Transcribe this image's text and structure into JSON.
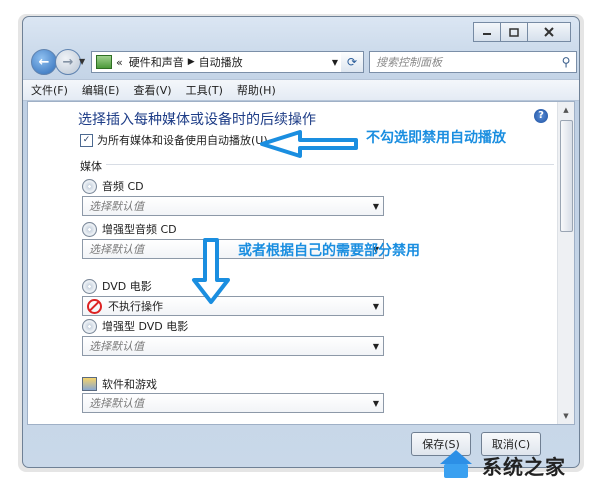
{
  "address": {
    "back_label": "←",
    "forward_label": "→",
    "history_glyph": "«",
    "crumbs": [
      "硬件和声音",
      "自动播放"
    ],
    "search_placeholder": "搜索控制面板"
  },
  "menu": [
    "文件(F)",
    "编辑(E)",
    "查看(V)",
    "工具(T)",
    "帮助(H)"
  ],
  "content": {
    "heading": "选择插入每种媒体或设备时的后续操作",
    "help_label": "?",
    "checkbox_label": "为所有媒体和设备使用自动播放(U)",
    "checkbox_checked": true,
    "section": "媒体",
    "items": [
      {
        "label": "音频 CD",
        "value": "选择默认值",
        "icon": "cd-icon"
      },
      {
        "label": "增强型音频 CD",
        "value": "选择默认值",
        "icon": "cd-icon"
      },
      {
        "label": "DVD 电影",
        "value": "不执行操作",
        "icon": "dvd-icon"
      },
      {
        "label": "增强型 DVD 电影",
        "value": "选择默认值",
        "icon": "dvd-icon"
      },
      {
        "label": "软件和游戏",
        "value": "选择默认值",
        "icon": "game-icon"
      }
    ]
  },
  "buttons": {
    "save": "保存(S)",
    "cancel": "取消(C)"
  },
  "annotations": {
    "note1": "不勾选即禁用自动播放",
    "note2": "或者根据自己的需要部分禁用",
    "color": "#1a8ee0"
  },
  "watermark": "系统之家"
}
